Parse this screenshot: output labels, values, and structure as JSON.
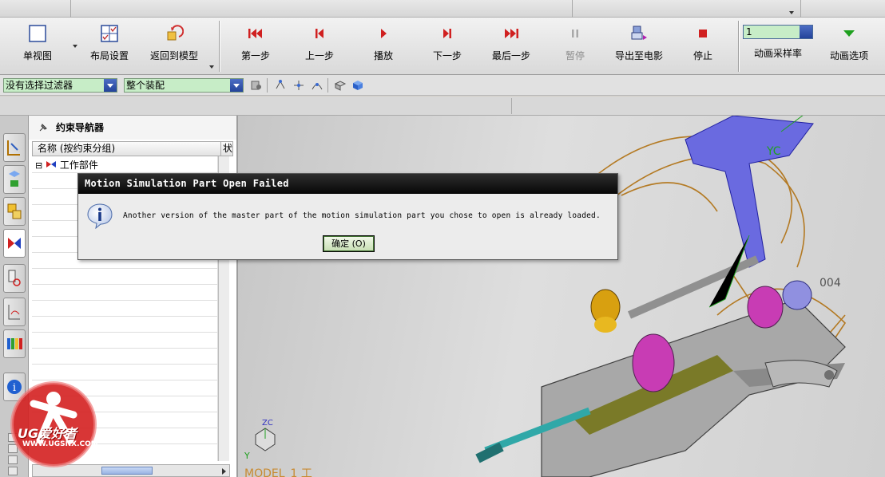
{
  "ribbon": {
    "view_group": [
      {
        "id": "single-view",
        "label": "单视图"
      },
      {
        "id": "layout-settings",
        "label": "布局设置"
      },
      {
        "id": "return-to-model",
        "label": "返回到模型"
      }
    ],
    "animation_group": [
      {
        "id": "first-step",
        "label": "第一步",
        "disabled": false
      },
      {
        "id": "previous-step",
        "label": "上一步",
        "disabled": false
      },
      {
        "id": "play",
        "label": "播放",
        "disabled": false
      },
      {
        "id": "next-step",
        "label": "下一步",
        "disabled": false
      },
      {
        "id": "last-step",
        "label": "最后一步",
        "disabled": false
      },
      {
        "id": "pause",
        "label": "暂停",
        "disabled": true
      },
      {
        "id": "export-movie",
        "label": "导出至电影",
        "disabled": false
      },
      {
        "id": "stop",
        "label": "停止",
        "disabled": false
      }
    ],
    "sample_rate": {
      "value": "1",
      "label": "动画采样率"
    },
    "animation_options_label": "动画选项"
  },
  "filter_bar": {
    "selection_filter": "没有选择过滤器",
    "assembly_scope": "整个装配"
  },
  "navigator": {
    "title": "约束导航器",
    "column_header": "名称 (按约束分组)",
    "column_header_2": "状",
    "tree": [
      {
        "label": "工作部件",
        "expander": "⊟"
      }
    ]
  },
  "viewport": {
    "axis_yc": "YC",
    "part_label_fragment": "004",
    "triad_zc": "ZC",
    "triad_y": "Y",
    "model_label": "MODEL_1 工",
    "watermark_text": "UG爱好者",
    "watermark_url": "WWW.UGSNX.COM"
  },
  "dialog": {
    "title": "Motion Simulation Part Open Failed",
    "message": "Another version of the master part of the motion simulation part you chose to open is already loaded.",
    "ok_label": "确定 (O)"
  },
  "colors": {
    "dialog_title_bg": "#0a0a0a",
    "combo_bg": "#c7edc7",
    "ok_border": "#3e6f2e",
    "accent_red": "#d02020"
  }
}
